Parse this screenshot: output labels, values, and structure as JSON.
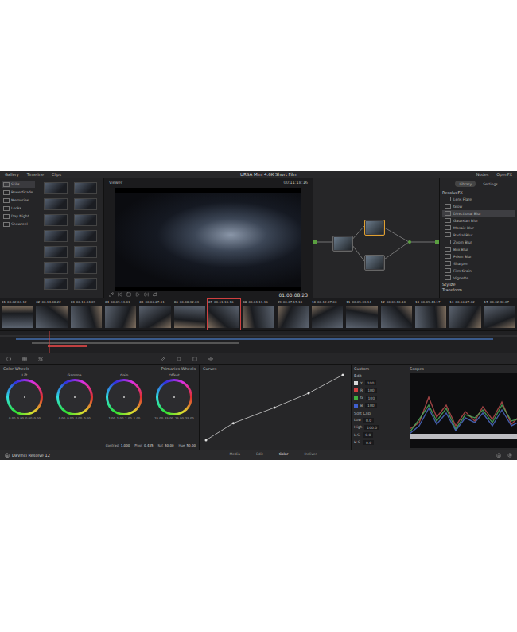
{
  "window": {
    "title": "URSA Mini 4.6K Short Film"
  },
  "top_bar": {
    "left": [
      {
        "label": "Gallery"
      },
      {
        "label": "Timeline"
      },
      {
        "label": "Clips"
      }
    ],
    "right": [
      {
        "label": "Nodes"
      },
      {
        "label": "OpenFX"
      }
    ]
  },
  "gallery": {
    "albums": [
      {
        "label": "Stills",
        "selected": true
      },
      {
        "label": "PowerGrade",
        "selected": false
      },
      {
        "label": "Memories",
        "selected": false
      },
      {
        "label": "Looks",
        "selected": false
      },
      {
        "label": "Day Night",
        "selected": false
      },
      {
        "label": "Showreel",
        "selected": false
      }
    ]
  },
  "viewer": {
    "header": "Viewer",
    "clip_timecode": "00:11:18:16",
    "timecode": "01:00:08:23"
  },
  "openfx": {
    "tabs": [
      {
        "label": "Library",
        "selected": true
      },
      {
        "label": "Settings",
        "selected": false
      }
    ],
    "group": "ResolveFX",
    "items": [
      {
        "label": "Lens Flare",
        "selected": false
      },
      {
        "label": "Glow",
        "selected": false
      },
      {
        "label": "Directional Blur",
        "selected": true
      },
      {
        "label": "Gaussian Blur",
        "selected": false
      },
      {
        "label": "Mosaic Blur",
        "selected": false
      },
      {
        "label": "Radial Blur",
        "selected": false
      },
      {
        "label": "Zoom Blur",
        "selected": false
      },
      {
        "label": "Box Blur",
        "selected": false
      },
      {
        "label": "Prism Blur",
        "selected": false
      },
      {
        "label": "Sharpen",
        "selected": false
      },
      {
        "label": "Film Grain",
        "selected": false
      },
      {
        "label": "Vignette",
        "selected": false
      }
    ],
    "footer": [
      "Stylize",
      "Transform"
    ]
  },
  "clips": [
    {
      "number": "01",
      "timecode": "00:02:04:12",
      "selected": false
    },
    {
      "number": "02",
      "timecode": "00:14:08:22",
      "selected": false
    },
    {
      "number": "03",
      "timecode": "00:11:04:09",
      "selected": false
    },
    {
      "number": "04",
      "timecode": "00:09:13:01",
      "selected": false
    },
    {
      "number": "05",
      "timecode": "00:06:27:11",
      "selected": false
    },
    {
      "number": "06",
      "timecode": "00:08:32:03",
      "selected": false
    },
    {
      "number": "07",
      "timecode": "00:11:18:16",
      "selected": true
    },
    {
      "number": "08",
      "timecode": "00:04:11:16",
      "selected": false
    },
    {
      "number": "09",
      "timecode": "00:07:15:18",
      "selected": false
    },
    {
      "number": "10",
      "timecode": "00:12:07:00",
      "selected": false
    },
    {
      "number": "11",
      "timecode": "00:05:33:14",
      "selected": false
    },
    {
      "number": "12",
      "timecode": "00:03:10:10",
      "selected": false
    },
    {
      "number": "13",
      "timecode": "00:09:44:17",
      "selected": false
    },
    {
      "number": "14",
      "timecode": "00:16:27:02",
      "selected": false
    },
    {
      "number": "15",
      "timecode": "00:02:40:07",
      "selected": false
    }
  ],
  "color_wheels": {
    "title": "Color Wheels",
    "mode": "Primaries Wheels",
    "wheels": [
      {
        "label": "Lift",
        "values": [
          "0.00",
          "0.00",
          "0.00",
          "0.00"
        ]
      },
      {
        "label": "Gamma",
        "values": [
          "0.00",
          "0.00",
          "0.00",
          "0.00"
        ]
      },
      {
        "label": "Gain",
        "values": [
          "1.00",
          "1.00",
          "1.00",
          "1.00"
        ]
      },
      {
        "label": "Offset",
        "values": [
          "25.00",
          "25.00",
          "25.00",
          "25.00"
        ]
      }
    ],
    "controls": [
      {
        "label": "Contrast",
        "value": "1.000"
      },
      {
        "label": "Pivot",
        "value": "0.435"
      },
      {
        "label": "Sat",
        "value": "50.00"
      },
      {
        "label": "Hue",
        "value": "50.00"
      }
    ]
  },
  "curves": {
    "title": "Curves",
    "points": [
      [
        0,
        0
      ],
      [
        0.2,
        0.26
      ],
      [
        0.5,
        0.5
      ],
      [
        0.75,
        0.72
      ],
      [
        1,
        1
      ]
    ]
  },
  "curve_edit": {
    "title": "Custom",
    "edit_label": "Edit",
    "channels": [
      {
        "label": "Y",
        "value": "100",
        "color": "#d8d8d8"
      },
      {
        "label": "R",
        "value": "100",
        "color": "#d04040"
      },
      {
        "label": "G",
        "value": "100",
        "color": "#40b040"
      },
      {
        "label": "B",
        "value": "100",
        "color": "#4060d0"
      }
    ],
    "soft_clip": "Soft Clip",
    "soft_rows": [
      {
        "label": "Low",
        "value": "0.0"
      },
      {
        "label": "High",
        "value": "100.0"
      },
      {
        "label": "L.S.",
        "value": "0.0"
      },
      {
        "label": "H.S.",
        "value": "0.0"
      }
    ]
  },
  "scopes": {
    "title": "Scopes",
    "mode": "Waveform"
  },
  "status_bar": {
    "app": "DaVinci Resolve 12",
    "pages": [
      {
        "label": "Media",
        "selected": false
      },
      {
        "label": "Edit",
        "selected": false
      },
      {
        "label": "Color",
        "selected": true
      },
      {
        "label": "Deliver",
        "selected": false
      }
    ]
  }
}
